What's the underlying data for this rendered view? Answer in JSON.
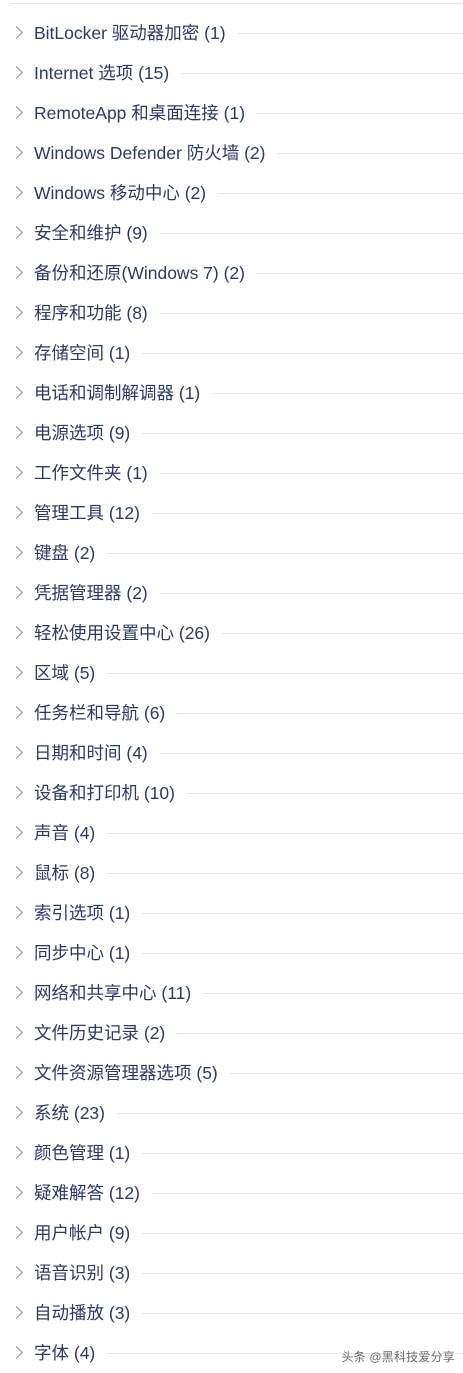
{
  "category_tree": {
    "items": [
      {
        "label": "BitLocker 驱动器加密 (1)"
      },
      {
        "label": "Internet 选项 (15)"
      },
      {
        "label": "RemoteApp 和桌面连接 (1)"
      },
      {
        "label": "Windows Defender 防火墙 (2)"
      },
      {
        "label": "Windows 移动中心 (2)"
      },
      {
        "label": "安全和维护 (9)"
      },
      {
        "label": "备份和还原(Windows 7) (2)"
      },
      {
        "label": "程序和功能 (8)"
      },
      {
        "label": "存储空间 (1)"
      },
      {
        "label": "电话和调制解调器 (1)"
      },
      {
        "label": "电源选项 (9)"
      },
      {
        "label": "工作文件夹 (1)"
      },
      {
        "label": "管理工具 (12)"
      },
      {
        "label": "键盘 (2)"
      },
      {
        "label": "凭据管理器 (2)"
      },
      {
        "label": "轻松使用设置中心 (26)"
      },
      {
        "label": "区域 (5)"
      },
      {
        "label": "任务栏和导航 (6)"
      },
      {
        "label": "日期和时间 (4)"
      },
      {
        "label": "设备和打印机 (10)"
      },
      {
        "label": "声音 (4)"
      },
      {
        "label": "鼠标 (8)"
      },
      {
        "label": "索引选项 (1)"
      },
      {
        "label": "同步中心 (1)"
      },
      {
        "label": "网络和共享中心 (11)"
      },
      {
        "label": "文件历史记录 (2)"
      },
      {
        "label": "文件资源管理器选项 (5)"
      },
      {
        "label": "系统 (23)"
      },
      {
        "label": "颜色管理 (1)"
      },
      {
        "label": "疑难解答 (12)"
      },
      {
        "label": "用户帐户 (9)"
      },
      {
        "label": "语音识别 (3)"
      },
      {
        "label": "自动播放 (3)"
      },
      {
        "label": "字体 (4)"
      }
    ]
  },
  "watermark": {
    "text": "头条 @黑科技爱分享"
  },
  "colors": {
    "label": "#2b3a67",
    "chevron": "#8a8f98",
    "leader_line": "#e3e6ea"
  },
  "icons": {
    "expander": "chevron-right-icon"
  }
}
